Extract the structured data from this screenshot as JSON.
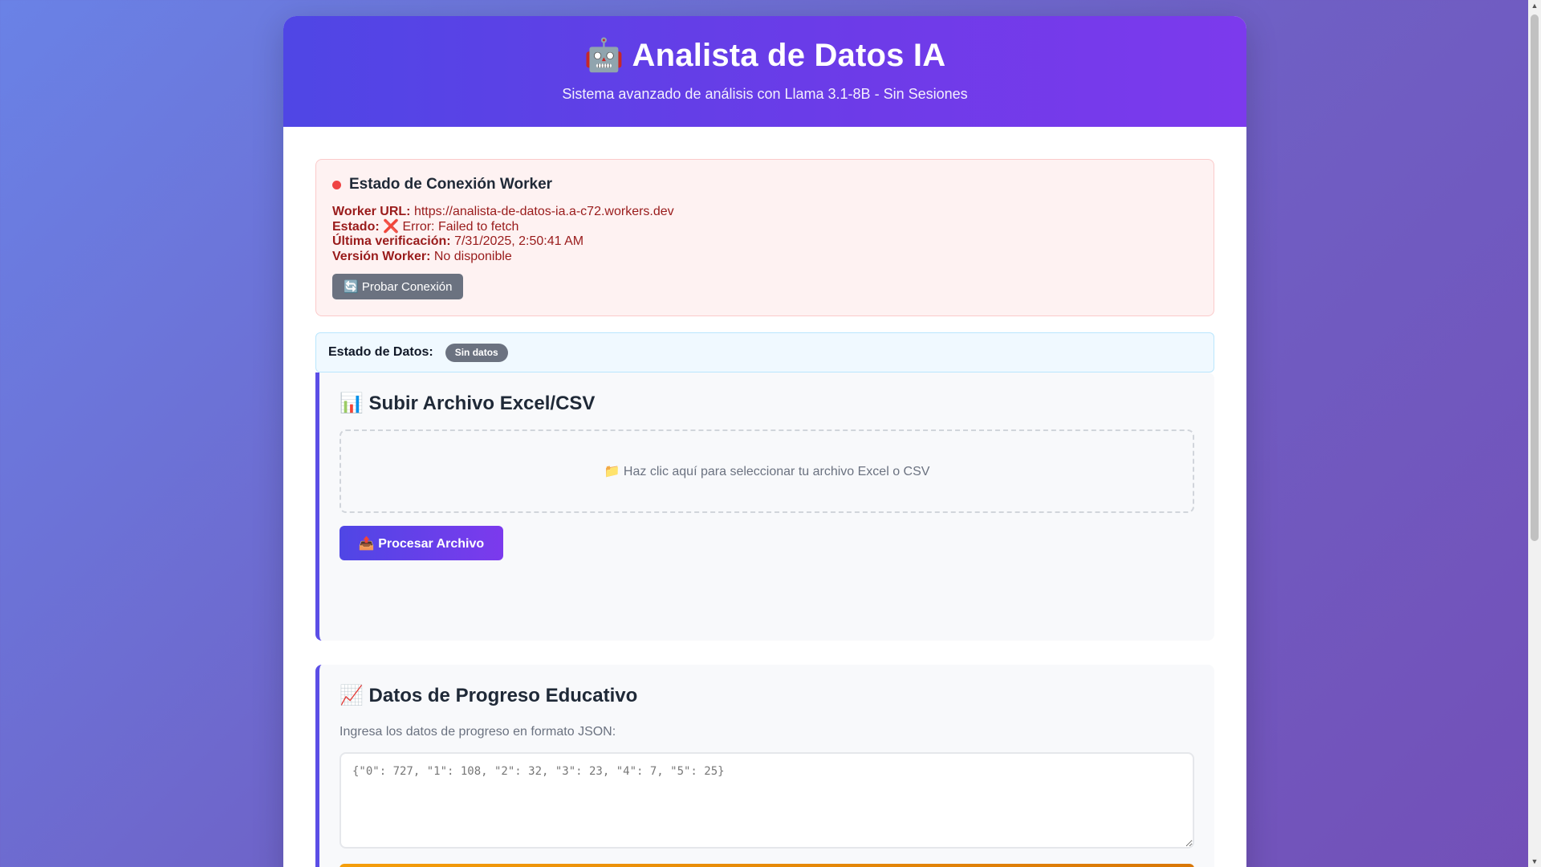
{
  "header": {
    "icon": "robot-icon",
    "title": "🤖 Analista de Datos IA",
    "subtitle": "Sistema avanzado de análisis con Llama 3.1-8B - Sin Sesiones"
  },
  "connection": {
    "title": "Estado de Conexión Worker",
    "status_color": "#ef4444",
    "rows": [
      {
        "label": "Worker URL:",
        "value": "https://analista-de-datos-ia.a-c72.workers.dev"
      },
      {
        "label": "Estado:",
        "value": "❌ Error: Failed to fetch"
      },
      {
        "label": "Última verificación:",
        "value": "7/31/2025, 2:50:41 AM"
      },
      {
        "label": "Versión Worker:",
        "value": "No disponible"
      }
    ],
    "test_button": "🔄 Probar Conexión"
  },
  "data_status": {
    "label": "Estado de Datos:",
    "badge": "Sin datos"
  },
  "upload": {
    "title": "📊 Subir Archivo Excel/CSV",
    "dropzone_text": "📁 Haz clic aquí para seleccionar tu archivo Excel o CSV",
    "process_button": "📤 Procesar Archivo"
  },
  "progress": {
    "title": "📈 Datos de Progreso Educativo",
    "label": "Ingresa los datos de progreso en formato JSON:",
    "placeholder": "{\"0\": 727, \"1\": 108, \"2\": 32, \"3\": 23, \"4\": 7, \"5\": 25}"
  },
  "colors": {
    "accent": "#5b4ee6",
    "error": "#ef4444",
    "warning": "#f59e0b"
  }
}
